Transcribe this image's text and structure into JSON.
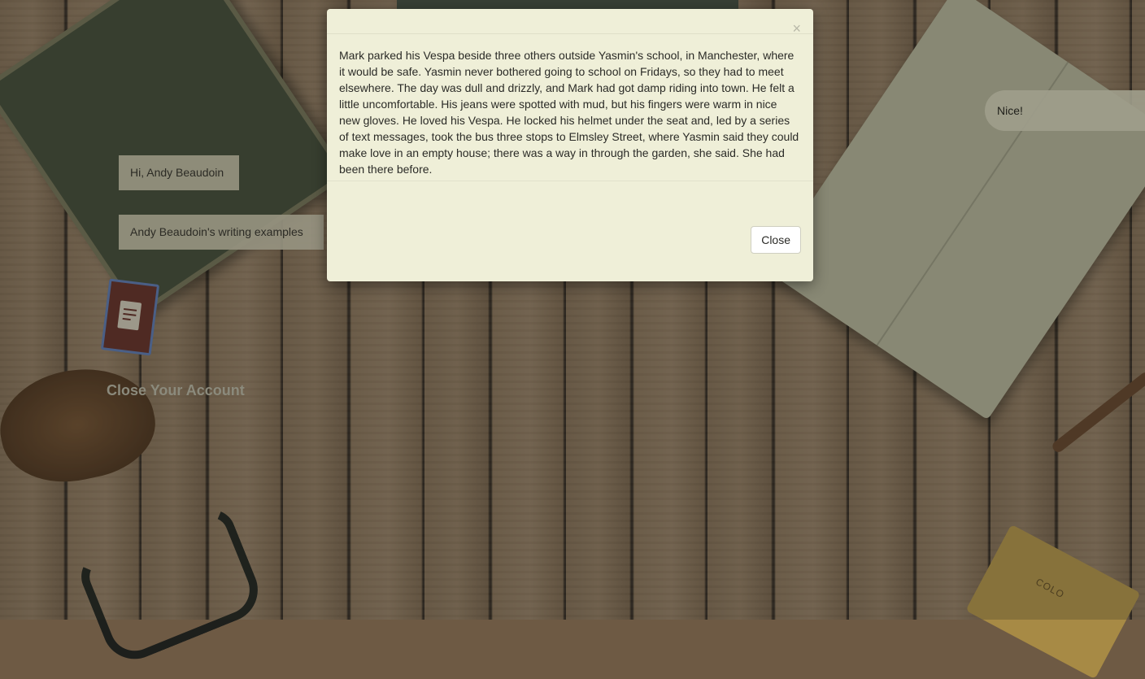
{
  "user": {
    "greeting": "Hi, Andy Beaudoin",
    "examples_link": "Andy Beaudoin's writing examples",
    "close_account": "Close Your Account"
  },
  "comment": {
    "text": "Nice!"
  },
  "modal": {
    "close_symbol": "×",
    "body": "Mark parked his Vespa beside three others outside Yasmin's school, in Manchester, where it would be safe. Yasmin never bothered going to school on Fridays, so they had to meet elsewhere. The day was dull and drizzly, and Mark had got damp riding into town. He felt a little uncomfortable. His jeans were spotted with mud, but his fingers were warm in nice new gloves. He loved his Vespa. He locked his helmet under the seat and, led by a series of text messages, took the bus three stops to Elmsley Street, where Yasmin said they could make love in an empty house; there was a way in through the garden, she said. She had been there before.",
    "close_button": "Close"
  },
  "icons": {
    "document": "document-icon"
  }
}
